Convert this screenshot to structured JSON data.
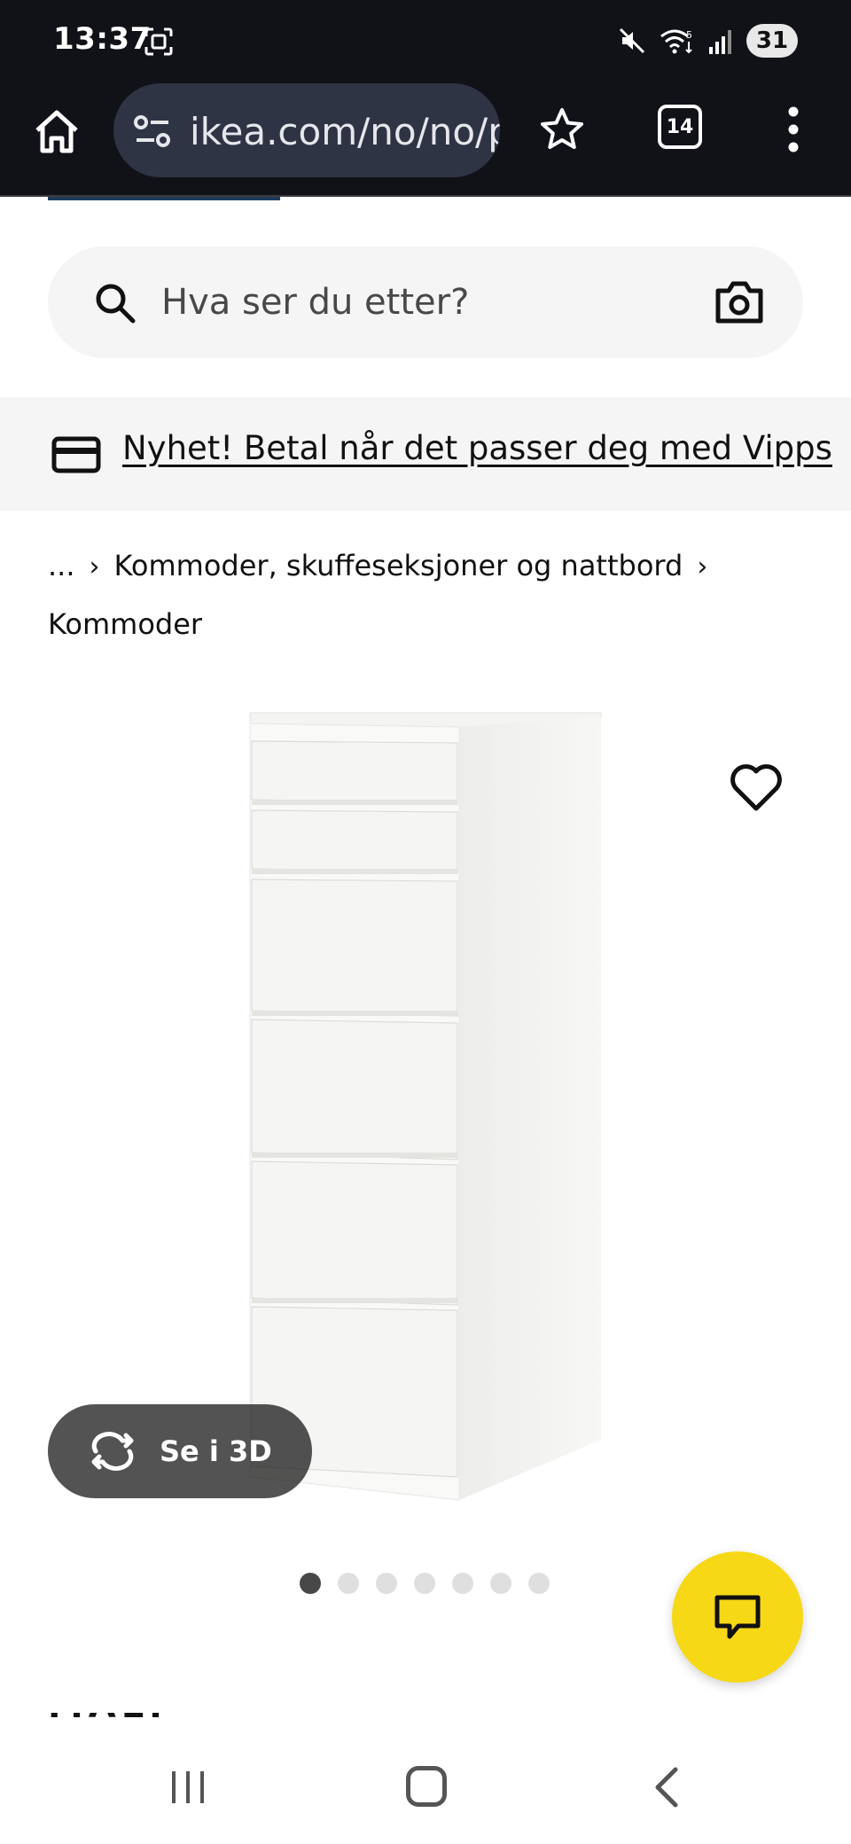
{
  "status_bar": {
    "time": "13:37",
    "battery": "31",
    "icons": [
      "screenshot-icon",
      "mute-icon",
      "wifi-icon",
      "signal-icon",
      "battery-icon"
    ]
  },
  "browser": {
    "url": "ikea.com/no/no/p",
    "tab_count": "14",
    "icons": [
      "home-icon",
      "site-settings-icon",
      "star-icon",
      "tabs-icon",
      "more-vert-icon"
    ]
  },
  "search": {
    "placeholder": "Hva ser du etter?"
  },
  "promo": {
    "text": "Nyhet! Betal når det passer deg med Vipps"
  },
  "breadcrumb": {
    "ellipsis": "...",
    "category": "Kommoder, skuffeseksjoner og nattbord",
    "current": "Kommoder"
  },
  "product": {
    "image_icon": "chest-of-drawers-image",
    "view_3d_label": "Se i 3D",
    "image_count": 7,
    "active_image": 1,
    "name_partial": "MALM"
  },
  "colors": {
    "status_bg": "#111218",
    "url_pill": "#2f3445",
    "chat_yellow": "#f6d816",
    "page_gray": "#f5f5f5"
  }
}
